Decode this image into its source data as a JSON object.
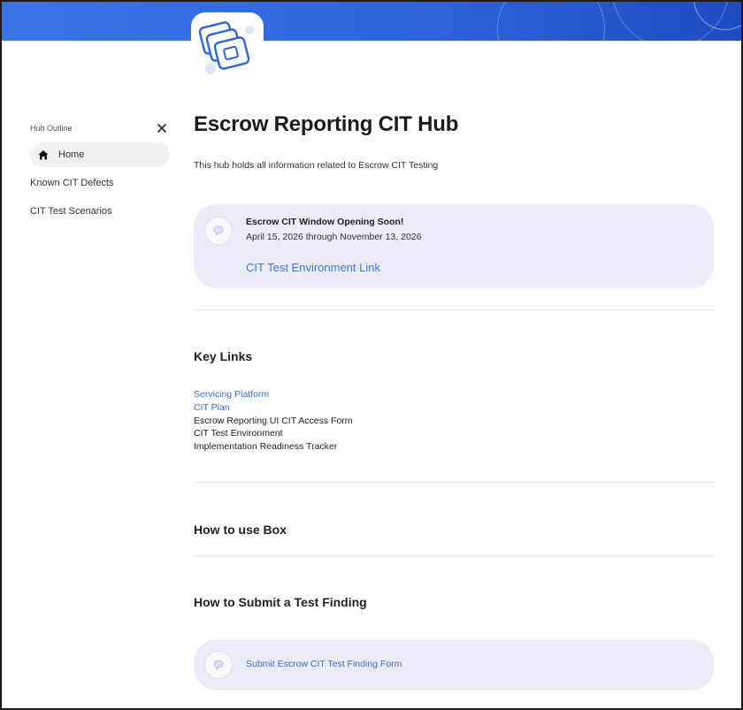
{
  "sidebar": {
    "header": "Hub Outline",
    "items": [
      {
        "label": "Home",
        "active": true
      },
      {
        "label": "Known CIT Defects",
        "active": false
      },
      {
        "label": "CIT Test Scenarios",
        "active": false
      }
    ]
  },
  "page": {
    "title": "Escrow Reporting CIT Hub",
    "subtitle": "This hub holds all information related to Escrow CIT Testing"
  },
  "callout1": {
    "title": "Escrow CIT Window Opening Soon!",
    "dates": "April 15, 2026 through November 13, 2026",
    "link": "CIT Test Environment Link"
  },
  "key_links": {
    "heading": "Key Links",
    "items": [
      {
        "label": "Servicing Platform",
        "is_link": true
      },
      {
        "label": "CIT Plan",
        "is_link": true
      },
      {
        "label": "Escrow Reporting UI CIT Access Form",
        "is_link": false
      },
      {
        "label": "CIT Test Environment",
        "is_link": false
      },
      {
        "label": "Implementation Readiness Tracker",
        "is_link": false
      }
    ]
  },
  "sections": {
    "how_to_use": "How to use Box",
    "how_to_submit": "How to Submit a Test Finding"
  },
  "callout2": {
    "link": "Submit Escrow CIT Test Finding Form"
  },
  "colors": {
    "banner": "#2f65dc",
    "link": "#3a6fd0",
    "callout_bg": "#ecebf8"
  },
  "icons": {
    "logo": "stacked-cards-logo-icon",
    "close": "close-icon",
    "home": "home-icon",
    "comment": "comment-bubble-icon"
  }
}
